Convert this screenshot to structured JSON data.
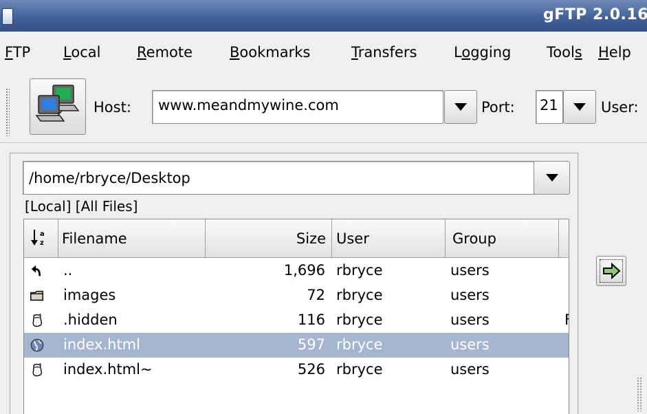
{
  "window": {
    "title": "gFTP 2.0.16"
  },
  "menubar": {
    "items": [
      {
        "pre": "",
        "ul": "F",
        "post": "TP"
      },
      {
        "pre": "",
        "ul": "L",
        "post": "ocal"
      },
      {
        "pre": "",
        "ul": "R",
        "post": "emote"
      },
      {
        "pre": "",
        "ul": "B",
        "post": "ookmarks"
      },
      {
        "pre": "",
        "ul": "T",
        "post": "ransfers"
      },
      {
        "pre": "L",
        "ul": "o",
        "post": "gging"
      },
      {
        "pre": "Tool",
        "ul": "s",
        "post": ""
      },
      {
        "pre": "",
        "ul": "H",
        "post": "elp"
      }
    ]
  },
  "toolbar": {
    "host_label": "Host:",
    "host_value": "www.meandmywine.com",
    "port_label": "Port:",
    "port_value": "21",
    "user_label": "User:"
  },
  "local": {
    "directory": "/home/rbryce/Desktop",
    "status": "[Local]  [All Files]",
    "columns": {
      "filename": "Filename",
      "size": "Size",
      "user": "User",
      "group": "Group"
    },
    "files": [
      {
        "icon": "up-arrow-icon",
        "name": "..",
        "size": "1,696",
        "user": "rbryce",
        "group": "users",
        "extra": "",
        "selected": false
      },
      {
        "icon": "folder-icon",
        "name": "images",
        "size": "72",
        "user": "rbryce",
        "group": "users",
        "extra": "",
        "selected": false
      },
      {
        "icon": "file-icon",
        "name": ".hidden",
        "size": "116",
        "user": "rbryce",
        "group": "users",
        "extra": "F",
        "selected": false
      },
      {
        "icon": "globe-icon",
        "name": "index.html",
        "size": "597",
        "user": "rbryce",
        "group": "users",
        "extra": "",
        "selected": true
      },
      {
        "icon": "file-icon",
        "name": "index.html~",
        "size": "526",
        "user": "rbryce",
        "group": "users",
        "extra": "",
        "selected": false
      }
    ]
  }
}
